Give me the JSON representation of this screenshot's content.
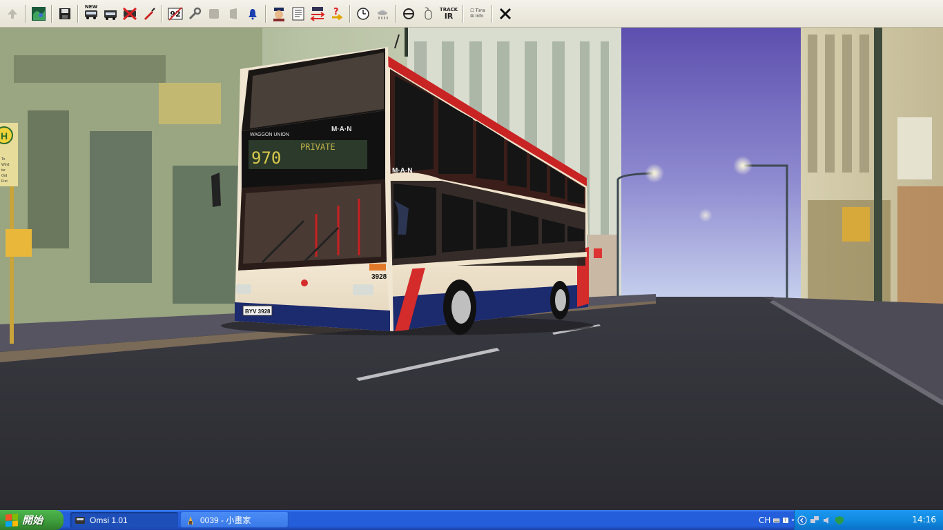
{
  "app": {
    "title": "Omsi 1.01"
  },
  "toolbar": {
    "new_label": "NEW",
    "track_line1": "TRACK",
    "track_line2": "IR",
    "bus_number_label": "92",
    "option_row1": "Tims",
    "option_row2": "Info"
  },
  "scene": {
    "bus": {
      "brand_top": "WAGGON UNION",
      "brand_logo": "M·A·N",
      "route_number": "970",
      "destination": "PRIVATE",
      "fleet_number": "3928",
      "plate": "BYV 3928"
    },
    "stop_sign": {
      "letter": "H",
      "line1": "To",
      "line2": "Wind",
      "line3": "ter",
      "line4": "Ord",
      "line5": "Frei"
    }
  },
  "taskbar": {
    "start_label": "開始",
    "items": [
      {
        "label": "Omsi 1.01"
      },
      {
        "label": "0039 - 小畫家"
      }
    ],
    "language": "CH",
    "clock": "14:16"
  }
}
